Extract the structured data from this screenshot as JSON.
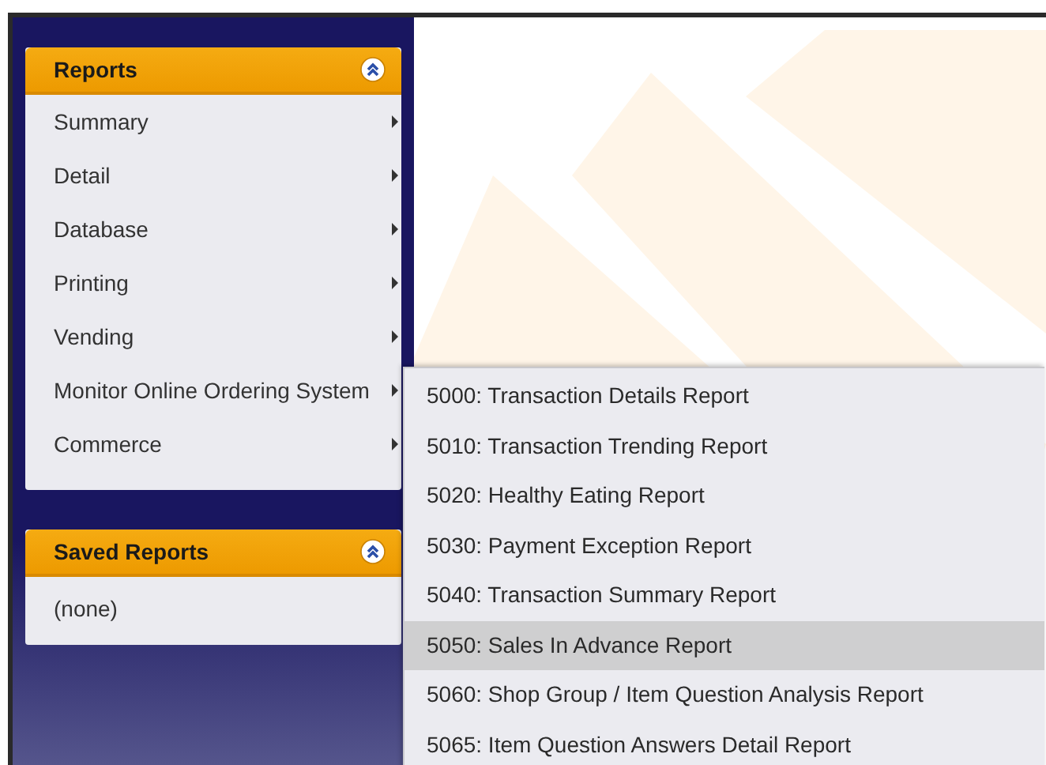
{
  "reports_panel": {
    "title": "Reports",
    "expanded": true,
    "items": [
      {
        "label": "Summary"
      },
      {
        "label": "Detail"
      },
      {
        "label": "Database"
      },
      {
        "label": "Printing"
      },
      {
        "label": "Vending"
      },
      {
        "label": "Monitor Online Ordering System"
      },
      {
        "label": "Commerce"
      }
    ]
  },
  "saved_reports_panel": {
    "title": "Saved Reports",
    "expanded": true,
    "empty_text": "(none)"
  },
  "submenu": {
    "items": [
      {
        "label": "5000: Transaction Details Report",
        "selected": false
      },
      {
        "label": "5010: Transaction Trending Report",
        "selected": false
      },
      {
        "label": "5020: Healthy Eating Report",
        "selected": false
      },
      {
        "label": "5030: Payment Exception Report",
        "selected": false
      },
      {
        "label": "5040: Transaction Summary Report",
        "selected": false
      },
      {
        "label": "5050: Sales In Advance Report",
        "selected": true
      },
      {
        "label": "5060: Shop Group / Item Question Analysis Report",
        "selected": false
      },
      {
        "label": "5065: Item Question Answers Detail Report",
        "selected": false
      }
    ]
  }
}
